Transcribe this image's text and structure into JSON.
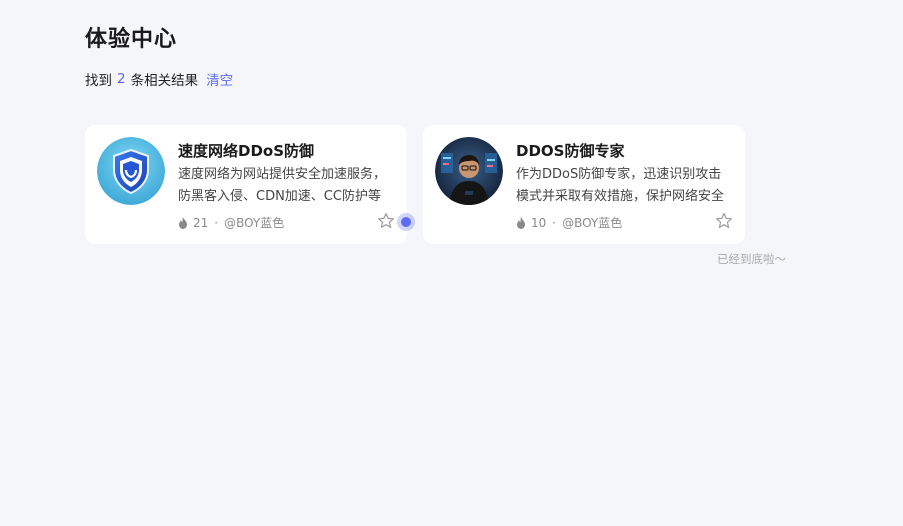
{
  "page": {
    "title": "体验中心",
    "result_prefix": "找到",
    "result_count": "2",
    "result_suffix": "条相关结果",
    "clear_label": "清空",
    "end_text": "已经到底啦～"
  },
  "colors": {
    "accent": "#5b6cf0",
    "background": "#f5f6fa",
    "card": "#ffffff"
  },
  "cards": [
    {
      "title": "速度网络DDoS防御",
      "desc": "速度网络为网站提供安全加速服务，防黑客入侵、CDN加速、CC防护等",
      "hot": "21",
      "dot": "·",
      "author": "@BOY蓝色",
      "avatar_icon": "shield-icon"
    },
    {
      "title": "DDOS防御专家",
      "desc": "作为DDoS防御专家，迅速识别攻击模式并采取有效措施，保护网络安全",
      "hot": "10",
      "dot": "·",
      "author": "@BOY蓝色",
      "avatar_icon": "person-avatar"
    }
  ]
}
